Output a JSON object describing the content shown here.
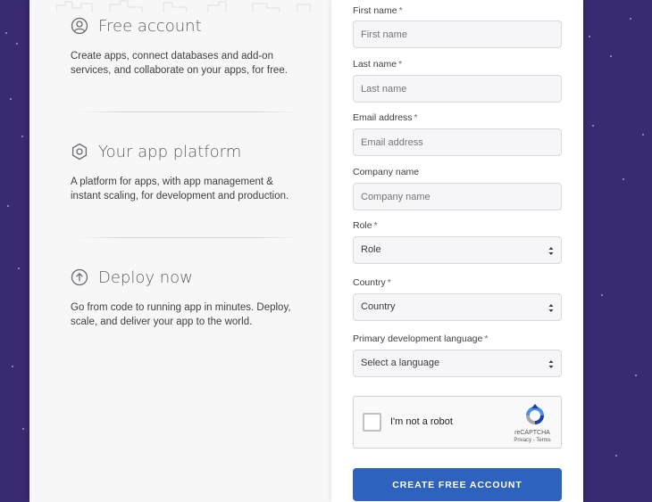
{
  "features": [
    {
      "icon": "user-icon",
      "title": "Free account",
      "description": "Create apps, connect databases and add-on services, and collaborate on your apps, for free."
    },
    {
      "icon": "hexagon-icon",
      "title": "Your app platform",
      "description": "A platform for apps, with app management & instant scaling, for development and production."
    },
    {
      "icon": "upload-arrow-icon",
      "title": "Deploy now",
      "description": "Go from code to running app in minutes. Deploy, scale, and deliver your app to the world."
    }
  ],
  "form": {
    "first_name": {
      "label": "First name",
      "required": "*",
      "placeholder": "First name"
    },
    "last_name": {
      "label": "Last name",
      "required": "*",
      "placeholder": "Last name"
    },
    "email": {
      "label": "Email address",
      "required": "*",
      "placeholder": "Email address"
    },
    "company": {
      "label": "Company name",
      "placeholder": "Company name"
    },
    "role": {
      "label": "Role",
      "required": "*",
      "value": "Role"
    },
    "country": {
      "label": "Country",
      "required": "*",
      "value": "Country"
    },
    "language": {
      "label": "Primary development language",
      "required": "*",
      "value": "Select a language"
    }
  },
  "captcha": {
    "label": "I'm not a robot",
    "brand": "reCAPTCHA",
    "links": "Privacy - Terms"
  },
  "submit_label": "CREATE FREE ACCOUNT",
  "colors": {
    "background": "#3a2a72",
    "button": "#2e62bf",
    "icon_stroke": "#6a6a72"
  }
}
